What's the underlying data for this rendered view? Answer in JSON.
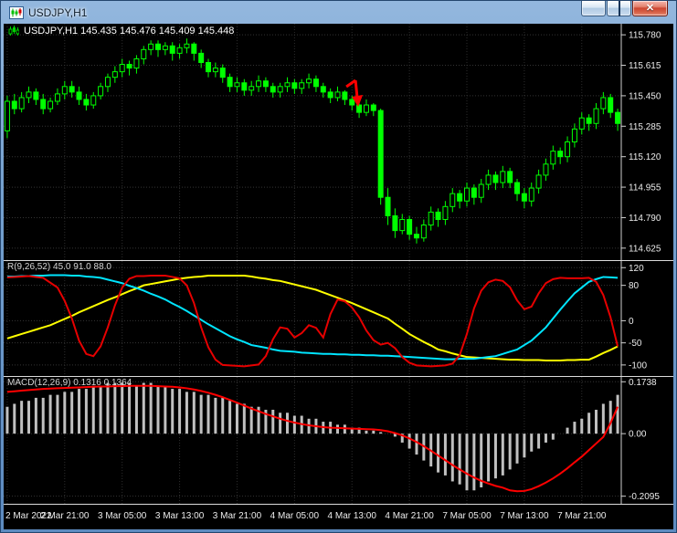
{
  "window": {
    "title": "USDJPY,H1",
    "icons": {
      "close": "✕"
    }
  },
  "readouts": {
    "price": "USDJPY,H1 145.435 145.476 145.409 145.448",
    "oscillator": "R(9,26,52) 45.0 91.0 88.0",
    "macd": "MACD(12,26,9) 0.1316 0.1364"
  },
  "time_axis": {
    "labels": [
      "2 Mar 2022",
      "2 Mar 21:00",
      "3 Mar 05:00",
      "3 Mar 13:00",
      "3 Mar 21:00",
      "4 Mar 05:00",
      "4 Mar 13:00",
      "4 Mar 21:00",
      "7 Mar 05:00",
      "7 Mar 13:00",
      "7 Mar 21:00"
    ],
    "label_indices": [
      0,
      8,
      16,
      24,
      32,
      40,
      48,
      56,
      64,
      72,
      80
    ]
  },
  "colors": {
    "background": "#000000",
    "frame": "#5d8bc0",
    "axis_text": "#ececec",
    "grid": "#2d2d2d",
    "candle": "#00ff00",
    "close_button": "#cc4631"
  },
  "chart_data": [
    {
      "type": "candlestick",
      "title": "USDJPY,H1",
      "ohlc_display": "145.435 145.476 145.409 145.448",
      "color": "#00ff00",
      "ylim": [
        114.56,
        115.84
      ],
      "y_ticks": [
        {
          "v": 115.78,
          "label": "115.780"
        },
        {
          "v": 115.615,
          "label": "115.615"
        },
        {
          "v": 115.45,
          "label": "115.450"
        },
        {
          "v": 115.285,
          "label": "115.285"
        },
        {
          "v": 115.12,
          "label": "115.120"
        },
        {
          "v": 114.955,
          "label": "114.955"
        },
        {
          "v": 114.79,
          "label": "114.790"
        },
        {
          "v": 114.625,
          "label": "114.625"
        }
      ],
      "annotation": {
        "name": "sell-arrow",
        "color": "#ff0000",
        "index": 49,
        "price": 115.4
      },
      "candles": [
        [
          115.26,
          115.45,
          115.22,
          115.42
        ],
        [
          115.42,
          115.46,
          115.35,
          115.38
        ],
        [
          115.38,
          115.47,
          115.36,
          115.44
        ],
        [
          115.44,
          115.5,
          115.41,
          115.47
        ],
        [
          115.47,
          115.49,
          115.4,
          115.43
        ],
        [
          115.43,
          115.46,
          115.35,
          115.38
        ],
        [
          115.38,
          115.44,
          115.36,
          115.42
        ],
        [
          115.42,
          115.49,
          115.4,
          115.46
        ],
        [
          115.46,
          115.53,
          115.43,
          115.5
        ],
        [
          115.5,
          115.53,
          115.44,
          115.47
        ],
        [
          115.47,
          115.5,
          115.4,
          115.43
        ],
        [
          115.43,
          115.46,
          115.37,
          115.4
        ],
        [
          115.4,
          115.47,
          115.38,
          115.45
        ],
        [
          115.45,
          115.52,
          115.43,
          115.5
        ],
        [
          115.5,
          115.57,
          115.47,
          115.55
        ],
        [
          115.55,
          115.61,
          115.52,
          115.58
        ],
        [
          115.58,
          115.65,
          115.55,
          115.62
        ],
        [
          115.62,
          115.64,
          115.56,
          115.6
        ],
        [
          115.6,
          115.67,
          115.57,
          115.65
        ],
        [
          115.65,
          115.72,
          115.62,
          115.7
        ],
        [
          115.7,
          115.75,
          115.67,
          115.73
        ],
        [
          115.73,
          115.75,
          115.66,
          115.7
        ],
        [
          115.7,
          115.74,
          115.67,
          115.72
        ],
        [
          115.72,
          115.74,
          115.64,
          115.68
        ],
        [
          115.68,
          115.73,
          115.65,
          115.71
        ],
        [
          115.71,
          115.76,
          115.68,
          115.73
        ],
        [
          115.73,
          115.74,
          115.64,
          115.68
        ],
        [
          115.68,
          115.7,
          115.6,
          115.63
        ],
        [
          115.63,
          115.65,
          115.55,
          115.58
        ],
        [
          115.58,
          115.63,
          115.55,
          115.6
        ],
        [
          115.6,
          115.62,
          115.52,
          115.55
        ],
        [
          115.55,
          115.57,
          115.47,
          115.5
        ],
        [
          115.5,
          115.55,
          115.47,
          115.52
        ],
        [
          115.52,
          115.54,
          115.45,
          115.48
        ],
        [
          115.48,
          115.53,
          115.45,
          115.5
        ],
        [
          115.5,
          115.56,
          115.47,
          115.53
        ],
        [
          115.53,
          115.55,
          115.47,
          115.5
        ],
        [
          115.5,
          115.52,
          115.44,
          115.47
        ],
        [
          115.47,
          115.52,
          115.44,
          115.5
        ],
        [
          115.5,
          115.55,
          115.47,
          115.52
        ],
        [
          115.52,
          115.54,
          115.46,
          115.49
        ],
        [
          115.49,
          115.54,
          115.46,
          115.52
        ],
        [
          115.52,
          115.57,
          115.49,
          115.54
        ],
        [
          115.54,
          115.56,
          115.47,
          115.5
        ],
        [
          115.5,
          115.52,
          115.44,
          115.47
        ],
        [
          115.47,
          115.49,
          115.41,
          115.44
        ],
        [
          115.44,
          115.5,
          115.42,
          115.47
        ],
        [
          115.47,
          115.48,
          115.4,
          115.43
        ],
        [
          115.43,
          115.45,
          115.37,
          115.4
        ],
        [
          115.4,
          115.42,
          115.33,
          115.36
        ],
        [
          115.36,
          115.43,
          115.34,
          115.4
        ],
        [
          115.4,
          115.41,
          115.34,
          115.37
        ],
        [
          115.37,
          115.38,
          114.86,
          114.9
        ],
        [
          114.9,
          114.95,
          114.75,
          114.8
        ],
        [
          114.8,
          114.84,
          114.68,
          114.72
        ],
        [
          114.72,
          114.81,
          114.7,
          114.78
        ],
        [
          114.78,
          114.8,
          114.67,
          114.7
        ],
        [
          114.7,
          114.74,
          114.65,
          114.68
        ],
        [
          114.68,
          114.78,
          114.66,
          114.75
        ],
        [
          114.75,
          114.85,
          114.72,
          114.82
        ],
        [
          114.82,
          114.84,
          114.74,
          114.78
        ],
        [
          114.78,
          114.88,
          114.75,
          114.85
        ],
        [
          114.85,
          114.95,
          114.82,
          114.92
        ],
        [
          114.92,
          114.94,
          114.84,
          114.88
        ],
        [
          114.88,
          114.98,
          114.85,
          114.95
        ],
        [
          114.95,
          114.97,
          114.86,
          114.9
        ],
        [
          114.9,
          115.0,
          114.87,
          114.97
        ],
        [
          114.97,
          115.05,
          114.94,
          115.02
        ],
        [
          115.02,
          115.04,
          114.94,
          114.98
        ],
        [
          114.98,
          115.07,
          114.95,
          115.04
        ],
        [
          115.04,
          115.06,
          114.95,
          114.98
        ],
        [
          114.98,
          115.0,
          114.88,
          114.92
        ],
        [
          114.92,
          114.95,
          114.84,
          114.88
        ],
        [
          114.88,
          114.98,
          114.85,
          114.95
        ],
        [
          114.95,
          115.05,
          114.92,
          115.02
        ],
        [
          115.02,
          115.11,
          114.99,
          115.08
        ],
        [
          115.08,
          115.18,
          115.05,
          115.15
        ],
        [
          115.15,
          115.17,
          115.08,
          115.12
        ],
        [
          115.12,
          115.23,
          115.09,
          115.2
        ],
        [
          115.2,
          115.3,
          115.17,
          115.27
        ],
        [
          115.27,
          115.36,
          115.24,
          115.33
        ],
        [
          115.33,
          115.35,
          115.26,
          115.3
        ],
        [
          115.3,
          115.41,
          115.27,
          115.38
        ],
        [
          115.38,
          115.47,
          115.35,
          115.44
        ],
        [
          115.44,
          115.46,
          115.33,
          115.36
        ],
        [
          115.36,
          115.38,
          115.26,
          115.3
        ]
      ]
    },
    {
      "type": "line",
      "title": "R(9,26,52)",
      "values_display": "45.0 91.0 88.0",
      "ylim": [
        -125,
        135
      ],
      "y_ticks": [
        {
          "v": 120,
          "label": "120"
        },
        {
          "v": 80,
          "label": "80"
        },
        {
          "v": 0,
          "label": "0"
        },
        {
          "v": -50,
          "label": "-50"
        },
        {
          "v": -100,
          "label": "-100"
        }
      ],
      "series": [
        {
          "name": "yellow",
          "color": "#ffff00",
          "values": [
            -40,
            -35,
            -30,
            -25,
            -20,
            -15,
            -10,
            -3,
            4,
            11,
            19,
            26,
            33,
            40,
            47,
            53,
            60,
            67,
            73,
            80,
            83,
            86,
            89,
            92,
            95,
            97,
            99,
            100,
            102,
            102,
            102,
            102,
            102,
            102,
            100,
            97,
            95,
            92,
            90,
            86,
            82,
            78,
            74,
            70,
            64,
            58,
            52,
            46,
            40,
            33,
            26,
            19,
            12,
            5,
            -7,
            -18,
            -30,
            -39,
            -48,
            -56,
            -65,
            -69,
            -74,
            -78,
            -82,
            -83,
            -84,
            -85,
            -86,
            -87,
            -88,
            -88,
            -89,
            -89,
            -89,
            -90,
            -90,
            -90,
            -89,
            -89,
            -88,
            -88,
            -81,
            -73,
            -66,
            -58
          ]
        },
        {
          "name": "aqua",
          "color": "#00e5ff",
          "values": [
            100,
            100,
            101,
            101,
            102,
            102,
            103,
            103,
            103,
            102,
            102,
            100,
            99,
            97,
            93,
            89,
            85,
            79,
            74,
            68,
            61,
            55,
            48,
            39,
            31,
            22,
            12,
            2,
            -8,
            -17,
            -26,
            -35,
            -42,
            -48,
            -55,
            -58,
            -61,
            -65,
            -68,
            -69,
            -70,
            -72,
            -73,
            -74,
            -75,
            -75,
            -76,
            -76,
            -77,
            -77,
            -78,
            -78,
            -79,
            -79,
            -80,
            -81,
            -82,
            -83,
            -84,
            -85,
            -86,
            -87,
            -87,
            -86,
            -86,
            -86,
            -84,
            -82,
            -80,
            -75,
            -70,
            -65,
            -55,
            -45,
            -30,
            -15,
            5,
            25,
            44,
            62,
            75,
            88,
            94,
            99,
            98,
            97
          ]
        },
        {
          "name": "red",
          "color": "#e60000",
          "values": [
            98,
            99,
            100,
            101,
            99,
            97,
            86,
            75,
            45,
            5,
            -45,
            -75,
            -80,
            -58,
            -15,
            35,
            75,
            95,
            101,
            101,
            102,
            102,
            102,
            99,
            96,
            80,
            40,
            -15,
            -60,
            -88,
            -100,
            -101,
            -102,
            -103,
            -101,
            -99,
            -80,
            -42,
            -15,
            -18,
            -38,
            -28,
            -10,
            -16,
            -38,
            15,
            48,
            44,
            30,
            8,
            -22,
            -44,
            -54,
            -50,
            -62,
            -82,
            -95,
            -101,
            -102,
            -103,
            -102,
            -101,
            -97,
            -78,
            -30,
            28,
            68,
            87,
            93,
            90,
            76,
            46,
            26,
            32,
            62,
            85,
            94,
            97,
            96,
            96,
            96,
            97,
            88,
            58,
            8,
            -58
          ]
        }
      ]
    },
    {
      "type": "macd",
      "title": "MACD(12,26,9)",
      "values_display": "0.1316 0.1364",
      "ylim": [
        -0.235,
        0.19
      ],
      "y_ticks": [
        {
          "v": 0.1738,
          "label": "0.1738"
        },
        {
          "v": 0,
          "label": "0.00"
        },
        {
          "v": -0.2095,
          "label": "-0.2095"
        }
      ],
      "histogram_color": "#c0c0c0",
      "signal_color": "#ff0000",
      "histogram": [
        0.09,
        0.1,
        0.11,
        0.11,
        0.12,
        0.12,
        0.13,
        0.13,
        0.14,
        0.14,
        0.15,
        0.15,
        0.16,
        0.16,
        0.17,
        0.17,
        0.17,
        0.17,
        0.16,
        0.17,
        0.17,
        0.16,
        0.16,
        0.15,
        0.15,
        0.14,
        0.14,
        0.13,
        0.13,
        0.12,
        0.12,
        0.11,
        0.1,
        0.1,
        0.09,
        0.09,
        0.08,
        0.08,
        0.07,
        0.07,
        0.06,
        0.06,
        0.05,
        0.05,
        0.04,
        0.04,
        0.03,
        0.03,
        0.02,
        0.02,
        0.01,
        0.01,
        0.005,
        0,
        -0.01,
        -0.03,
        -0.05,
        -0.07,
        -0.09,
        -0.11,
        -0.13,
        -0.14,
        -0.16,
        -0.17,
        -0.19,
        -0.19,
        -0.18,
        -0.16,
        -0.15,
        -0.14,
        -0.12,
        -0.1,
        -0.08,
        -0.06,
        -0.05,
        -0.03,
        -0.02,
        0,
        0.02,
        0.04,
        0.05,
        0.07,
        0.08,
        0.1,
        0.11,
        0.13
      ],
      "signal": [
        0.14,
        0.142,
        0.144,
        0.146,
        0.148,
        0.15,
        0.151,
        0.152,
        0.153,
        0.154,
        0.155,
        0.156,
        0.157,
        0.158,
        0.158,
        0.159,
        0.159,
        0.16,
        0.16,
        0.16,
        0.16,
        0.159,
        0.158,
        0.157,
        0.155,
        0.152,
        0.148,
        0.143,
        0.137,
        0.13,
        0.122,
        0.113,
        0.104,
        0.094,
        0.084,
        0.075,
        0.066,
        0.058,
        0.05,
        0.043,
        0.037,
        0.032,
        0.028,
        0.025,
        0.022,
        0.02,
        0.019,
        0.018,
        0.017,
        0.016,
        0.015,
        0.014,
        0.012,
        0.008,
        0.002,
        -0.006,
        -0.016,
        -0.028,
        -0.042,
        -0.057,
        -0.073,
        -0.089,
        -0.105,
        -0.12,
        -0.134,
        -0.147,
        -0.158,
        -0.167,
        -0.175,
        -0.181,
        -0.19,
        -0.193,
        -0.192,
        -0.186,
        -0.176,
        -0.164,
        -0.15,
        -0.134,
        -0.116,
        -0.096,
        -0.077,
        -0.055,
        -0.033,
        -0.011,
        0.035,
        0.09
      ]
    }
  ]
}
